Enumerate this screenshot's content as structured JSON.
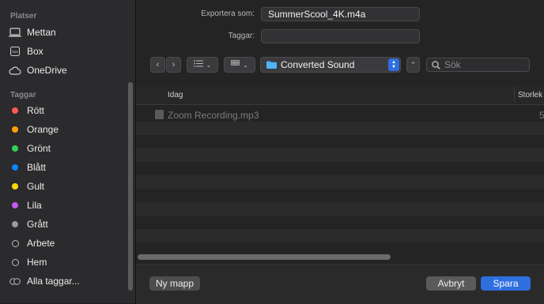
{
  "sidebar": {
    "places_title": "Platser",
    "places": [
      {
        "label": "Mettan",
        "icon": "laptop-icon"
      },
      {
        "label": "Box",
        "icon": "box-icon"
      },
      {
        "label": "OneDrive",
        "icon": "cloud-icon"
      }
    ],
    "tags_title": "Taggar",
    "tags": [
      {
        "label": "Rött",
        "color": "#ff5a52"
      },
      {
        "label": "Orange",
        "color": "#ff9f0a"
      },
      {
        "label": "Grönt",
        "color": "#30d158"
      },
      {
        "label": "Blått",
        "color": "#0a84ff"
      },
      {
        "label": "Gult",
        "color": "#ffd60a"
      },
      {
        "label": "Lila",
        "color": "#bf5af2"
      },
      {
        "label": "Grått",
        "color": "#98989d"
      },
      {
        "label": "Arbete",
        "color": ""
      },
      {
        "label": "Hem",
        "color": ""
      },
      {
        "label": "Alla taggar...",
        "color": ""
      }
    ]
  },
  "form": {
    "export_label": "Exportera som:",
    "export_value": "SummerScool_4K.m4a",
    "tags_label": "Taggar:",
    "tags_value": ""
  },
  "toolbar": {
    "location": "Converted Sound",
    "search_placeholder": "Sök"
  },
  "list": {
    "columns": [
      "Idag",
      "Storlek"
    ],
    "files": [
      {
        "name": "Zoom Recording.mp3",
        "size": "5"
      }
    ]
  },
  "buttons": {
    "new_folder": "Ny mapp",
    "cancel": "Avbryt",
    "save": "Spara"
  },
  "colors": {
    "accent": "#2e6fe0",
    "folder": "#4fb3f5"
  }
}
